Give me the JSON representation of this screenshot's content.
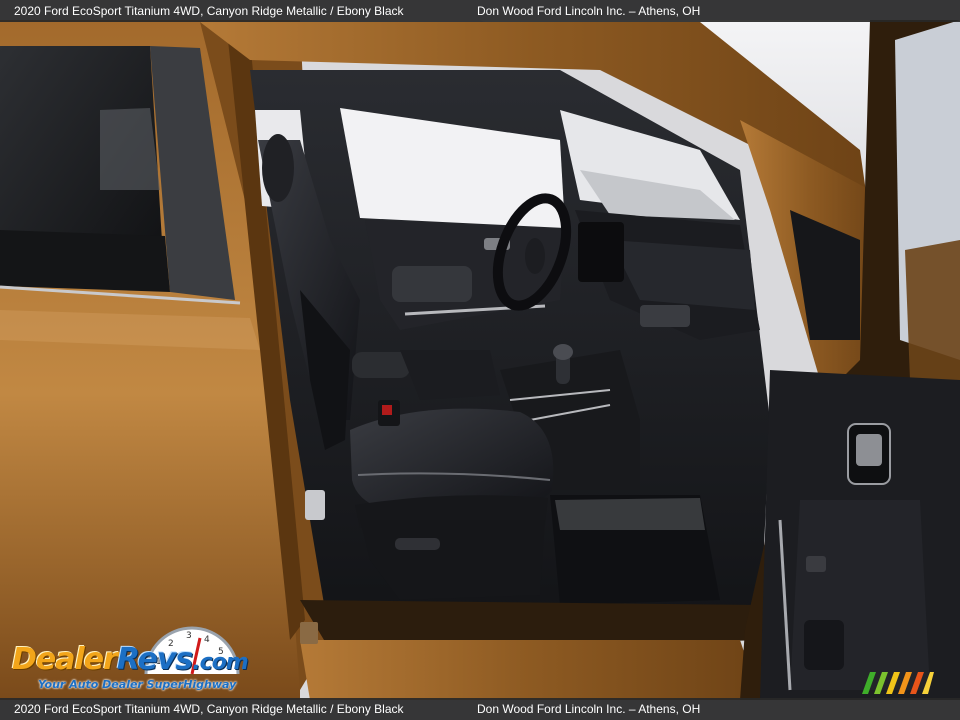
{
  "caption": {
    "left": "2020 Ford EcoSport Titanium 4WD,  Canyon Ridge Metallic / Ebony Black",
    "right": "Don Wood Ford Lincoln Inc. – Athens, OH"
  },
  "watermark": {
    "brand_part1": "Dealer",
    "brand_part2": "Revs",
    "brand_part3": ".com",
    "tagline": "Your Auto Dealer SuperHighway",
    "gauge_digits": "1 2 3 4 5 6"
  },
  "colors": {
    "body_paint": "#8a5a22",
    "interior": "#1e1f24",
    "caption_bg": "#2a2a2a",
    "logo_orange": "#f2a51a",
    "logo_blue": "#1c6fc4"
  }
}
